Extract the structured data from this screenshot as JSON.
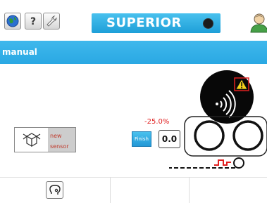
{
  "toolbar": {
    "title": "SUPERIOR",
    "icons": [
      "globe-icon",
      "help-icon",
      "wrench-icon",
      "user-icon"
    ]
  },
  "mode": {
    "label": "manual"
  },
  "sensor": {
    "label_line1": "new",
    "label_line2": "sensor"
  },
  "control": {
    "percent": "-25.0%",
    "finish_label": "Finish",
    "value": "0.0"
  },
  "colors": {
    "accent_blue": "#2aa8e3",
    "alert_red": "#e02020",
    "warning_yellow": "#f3d21a"
  }
}
